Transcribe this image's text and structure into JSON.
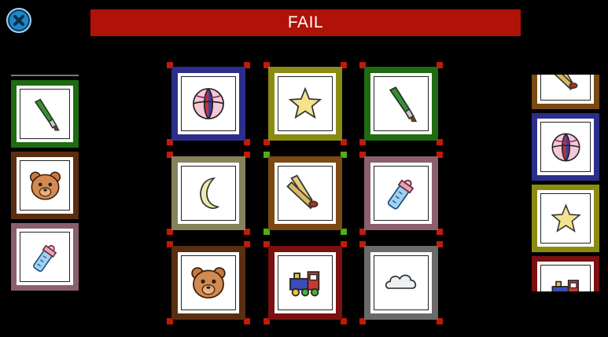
{
  "banner": {
    "text": "FAIL"
  },
  "close_button": {
    "icon": "close-icon",
    "color": "#1f86c8"
  },
  "colors": {
    "banner": "#b01208",
    "corner_red": "#c11a0a",
    "corner_green": "#4cb01a",
    "frame_blue": "#2b2f8a",
    "frame_olive": "#8b8b12",
    "frame_green": "#1e6b12",
    "frame_khaki": "#85825c",
    "frame_brown": "#7a4a12",
    "frame_mauve": "#8a5f6e",
    "frame_darkbrown": "#5a2e10",
    "frame_maroon": "#7a1010",
    "frame_gray": "#6a6a6a"
  },
  "left_stack": [
    {
      "icon": "paintbrush-icon",
      "frame": "frame_green"
    },
    {
      "icon": "teddy-bear-icon",
      "frame": "frame_darkbrown"
    },
    {
      "icon": "baby-bottle-icon",
      "frame": "frame_mauve"
    }
  ],
  "grid": [
    {
      "icon": "ball-icon",
      "frame": "frame_blue",
      "corners": "corner_red"
    },
    {
      "icon": "star-icon",
      "frame": "frame_olive",
      "corners": "corner_red"
    },
    {
      "icon": "paintbrush-icon",
      "frame": "frame_green",
      "corners": "corner_red"
    },
    {
      "icon": "moon-icon",
      "frame": "frame_khaki",
      "corners": "corner_red"
    },
    {
      "icon": "horns-icon",
      "frame": "frame_brown",
      "corners": "corner_green"
    },
    {
      "icon": "baby-bottle-icon",
      "frame": "frame_mauve",
      "corners": "corner_red"
    },
    {
      "icon": "teddy-bear-icon",
      "frame": "frame_darkbrown",
      "corners": "corner_red"
    },
    {
      "icon": "train-icon",
      "frame": "frame_maroon",
      "corners": "corner_red"
    },
    {
      "icon": "cloud-icon",
      "frame": "frame_gray",
      "corners": "corner_red"
    }
  ],
  "right_stack": [
    {
      "icon": "horns-icon",
      "frame": "frame_brown"
    },
    {
      "icon": "ball-icon",
      "frame": "frame_blue"
    },
    {
      "icon": "star-icon",
      "frame": "frame_olive"
    },
    {
      "icon": "train-icon",
      "frame": "frame_maroon"
    }
  ]
}
